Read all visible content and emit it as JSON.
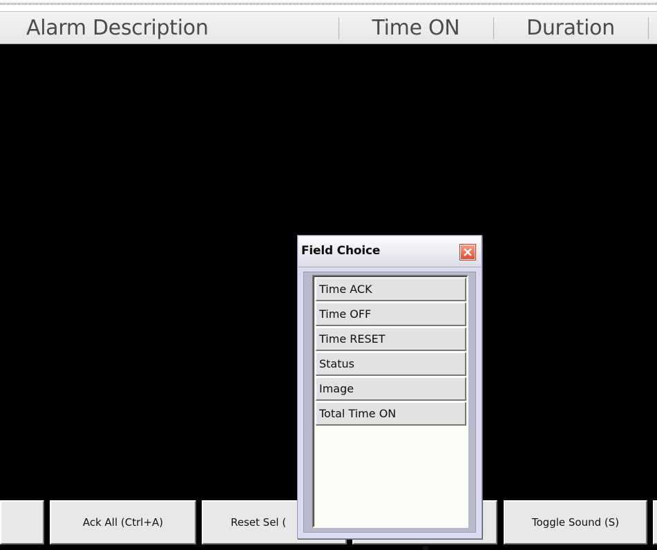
{
  "alarm_table": {
    "columns": [
      "Alarm Description",
      "Time ON",
      "Duration"
    ]
  },
  "button_bar": {
    "ack_all_label": "Ack All (Ctrl+A)",
    "reset_sel_label": "Reset Sel (",
    "toggle_sound_label": "Toggle Sound (S)"
  },
  "field_choice_dialog": {
    "title": "Field Choice",
    "close_icon": "close-icon",
    "items": [
      "Time ACK",
      "Time OFF",
      "Time RESET",
      "Status",
      "Image",
      "Total Time ON"
    ]
  },
  "colors": {
    "alarm_background": "#000000",
    "header_background": "#f0f0f0",
    "close_button": "#e84a2c",
    "dialog_frame": "#dcdcf0"
  }
}
